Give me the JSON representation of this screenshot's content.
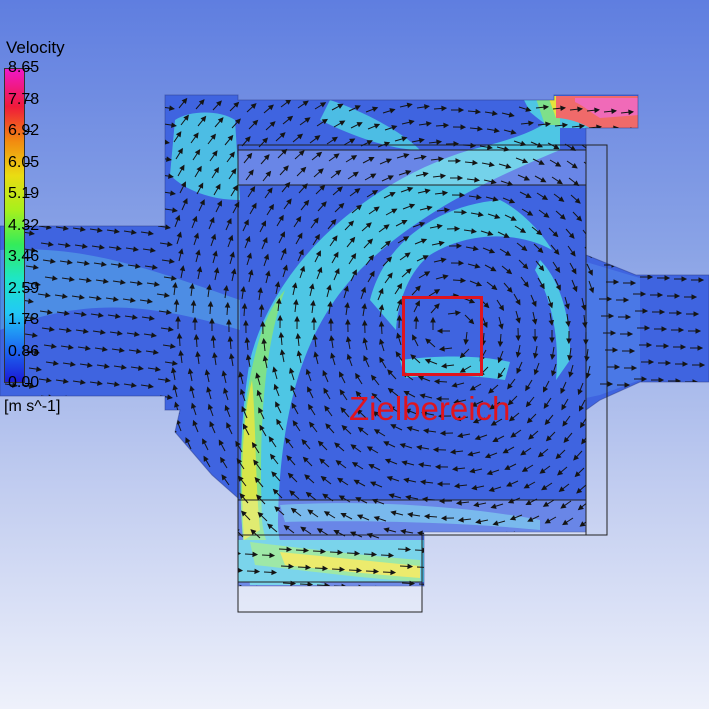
{
  "legend": {
    "title": "Velocity",
    "unit": "[m s^-1]",
    "ticks": [
      "8.65",
      "7.78",
      "6.92",
      "6.05",
      "5.19",
      "4.32",
      "3.46",
      "2.59",
      "1.73",
      "0.86",
      "0.00"
    ],
    "colors": [
      "#1a1ad6",
      "#1e6df2",
      "#22c8f6",
      "#1ee6c6",
      "#34ec5a",
      "#a8f01c",
      "#eadc12",
      "#f28a10",
      "#f01a3a",
      "#f018c8"
    ]
  },
  "annotation": {
    "label": "Zielbereich",
    "color": "#e0141e"
  }
}
